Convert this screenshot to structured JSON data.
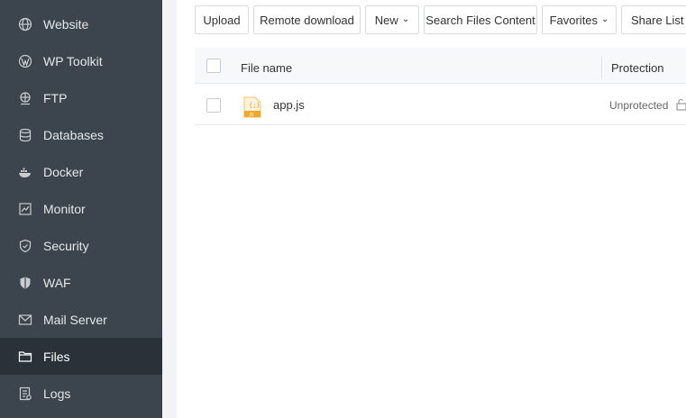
{
  "sidebar": {
    "items": [
      {
        "label": "Website",
        "icon": "globe-icon",
        "active": false
      },
      {
        "label": "WP Toolkit",
        "icon": "wordpress-icon",
        "active": false
      },
      {
        "label": "FTP",
        "icon": "ftp-icon",
        "active": false
      },
      {
        "label": "Databases",
        "icon": "database-icon",
        "active": false
      },
      {
        "label": "Docker",
        "icon": "docker-icon",
        "active": false
      },
      {
        "label": "Monitor",
        "icon": "monitor-icon",
        "active": false
      },
      {
        "label": "Security",
        "icon": "shield-icon",
        "active": false
      },
      {
        "label": "WAF",
        "icon": "waf-shield-icon",
        "active": false
      },
      {
        "label": "Mail Server",
        "icon": "mail-icon",
        "active": false
      },
      {
        "label": "Files",
        "icon": "folder-icon",
        "active": true
      },
      {
        "label": "Logs",
        "icon": "logs-icon",
        "active": false
      }
    ]
  },
  "toolbar": {
    "upload": "Upload",
    "remote_download": "Remote download",
    "new": "New",
    "search_files_content": "Search Files Content",
    "favorites": "Favorites",
    "share_list": "Share List"
  },
  "table": {
    "headers": {
      "file_name": "File name",
      "protection": "Protection"
    },
    "rows": [
      {
        "name": "app.js",
        "protection": "Unprotected",
        "icon": "js-file-icon"
      }
    ]
  },
  "colors": {
    "sidebar_bg": "#3c444d",
    "sidebar_active": "#2b3138",
    "js_icon": "#f0a92a"
  }
}
